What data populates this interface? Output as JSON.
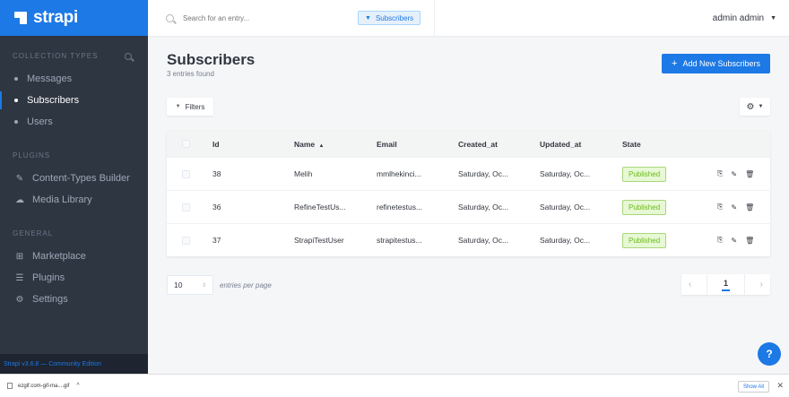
{
  "brand": {
    "name": "strapi"
  },
  "sidebar": {
    "collection_types_title": "COLLECTION TYPES",
    "collection_items": [
      {
        "label": "Messages",
        "active": false
      },
      {
        "label": "Subscribers",
        "active": true
      },
      {
        "label": "Users",
        "active": false
      }
    ],
    "plugins_title": "PLUGINS",
    "plugin_items": [
      {
        "label": "Content-Types Builder",
        "icon": "paintbrush-icon"
      },
      {
        "label": "Media Library",
        "icon": "cloud-upload-icon"
      }
    ],
    "general_title": "GENERAL",
    "general_items": [
      {
        "label": "Marketplace",
        "icon": "shopping-basket-icon"
      },
      {
        "label": "Plugins",
        "icon": "list-icon"
      },
      {
        "label": "Settings",
        "icon": "gear-icon"
      }
    ],
    "footer": "Strapi v3.6.8 — Community Edition"
  },
  "header": {
    "search_placeholder": "Search for an entry...",
    "tag_label": "Subscribers",
    "user_name": "admin admin"
  },
  "main": {
    "title": "Subscribers",
    "subtitle": "3 entries found",
    "add_button": "Add New Subscribers",
    "filters_button": "Filters"
  },
  "table": {
    "columns": [
      "Id",
      "Name",
      "Email",
      "Created_at",
      "Updated_at",
      "State"
    ],
    "sort_indicator": "▲",
    "rows": [
      {
        "id": "38",
        "name": "Melih",
        "email": "mmlhekinci...",
        "created": "Saturday, Oc...",
        "updated": "Saturday, Oc...",
        "state": "Published"
      },
      {
        "id": "36",
        "name": "RefineTestUs...",
        "email": "refinetestus...",
        "created": "Saturday, Oc...",
        "updated": "Saturday, Oc...",
        "state": "Published"
      },
      {
        "id": "37",
        "name": "StrapiTestUser",
        "email": "strapitestus...",
        "created": "Saturday, Oc...",
        "updated": "Saturday, Oc...",
        "state": "Published"
      }
    ]
  },
  "pagination": {
    "per_page": "10",
    "per_page_label": "entries per page",
    "current_page": "1"
  },
  "help_label": "?",
  "download_bar": {
    "file_name": "ezgif.com-gif-ma....gif",
    "show_all": "Show All"
  },
  "colors": {
    "accent": "#1c79e6",
    "sidebar_bg": "#2e3641",
    "published_bg": "#e6f8d4",
    "published_text": "#6dbb1a"
  }
}
